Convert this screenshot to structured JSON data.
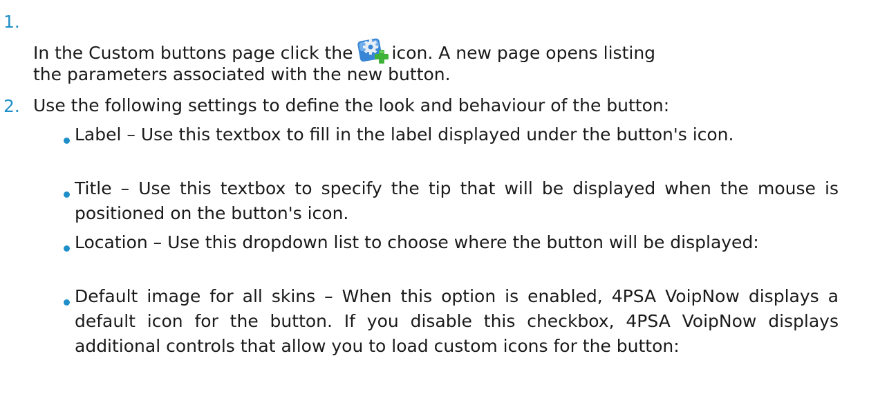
{
  "steps": [
    {
      "number": "1.",
      "line1_before_icon": "In the Custom buttons page click the",
      "icon": "add-custom-button-gear-icon",
      "line1_after_icon": "icon. A new page opens listing",
      "line2": "the parameters associated with the new button."
    },
    {
      "number": "2.",
      "text": "Use the following settings to define the look and behaviour of the button:",
      "items": [
        {
          "text": "Label – Use this textbox to fill in the label displayed under the button's icon."
        },
        {
          "text": "Title – Use this textbox to specify the tip that will be displayed when the mouse is positioned on the button's icon."
        },
        {
          "text": "Location – Use this dropdown list to choose where the button will be displayed:"
        },
        {
          "text": "Default image for all skins – When this option is enabled, 4PSA VoipNow displays a default icon for the button. If you disable this checkbox, 4PSA VoipNow displays additional controls that allow you to load custom icons for the button:"
        }
      ]
    }
  ],
  "colors": {
    "accent": "#1e8fc8",
    "text": "#1a1a1a",
    "icon_gear": "#3a86d6",
    "icon_plus": "#3fb23a"
  }
}
